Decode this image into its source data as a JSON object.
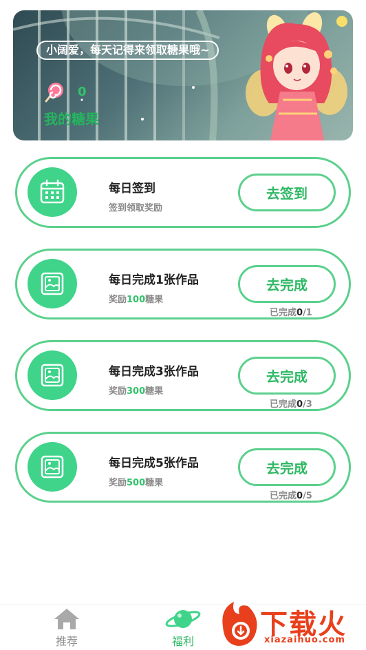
{
  "banner": {
    "greeting": "小阔爱，每天记得来领取糖果哦~",
    "candy_count": "0",
    "candy_label": "我的糖果"
  },
  "tasks": [
    {
      "icon": "calendar-icon",
      "title": "每日签到",
      "subtitle": "签到领取奖励",
      "action": "去签到"
    },
    {
      "icon": "image-icon",
      "title": "每日完成1张作品",
      "reward_prefix": "奖励",
      "reward_amount": "100",
      "reward_suffix": "糖果",
      "action": "去完成",
      "progress_prefix": "已完成",
      "progress_done": "0",
      "progress_total": "/1"
    },
    {
      "icon": "image-icon",
      "title": "每日完成3张作品",
      "reward_prefix": "奖励",
      "reward_amount": "300",
      "reward_suffix": "糖果",
      "action": "去完成",
      "progress_prefix": "已完成",
      "progress_done": "0",
      "progress_total": "/3"
    },
    {
      "icon": "image-icon",
      "title": "每日完成5张作品",
      "reward_prefix": "奖励",
      "reward_amount": "500",
      "reward_suffix": "糖果",
      "action": "去完成",
      "progress_prefix": "已完成",
      "progress_done": "0",
      "progress_total": "/5"
    }
  ],
  "nav": {
    "recommend": "推荐",
    "welfare": "福利"
  },
  "watermark": {
    "text": "下载火",
    "sub": "xiazaihuo.com"
  },
  "colors": {
    "accent": "#3fd48a",
    "border": "#5bd08c",
    "text_green": "#2fb865"
  }
}
